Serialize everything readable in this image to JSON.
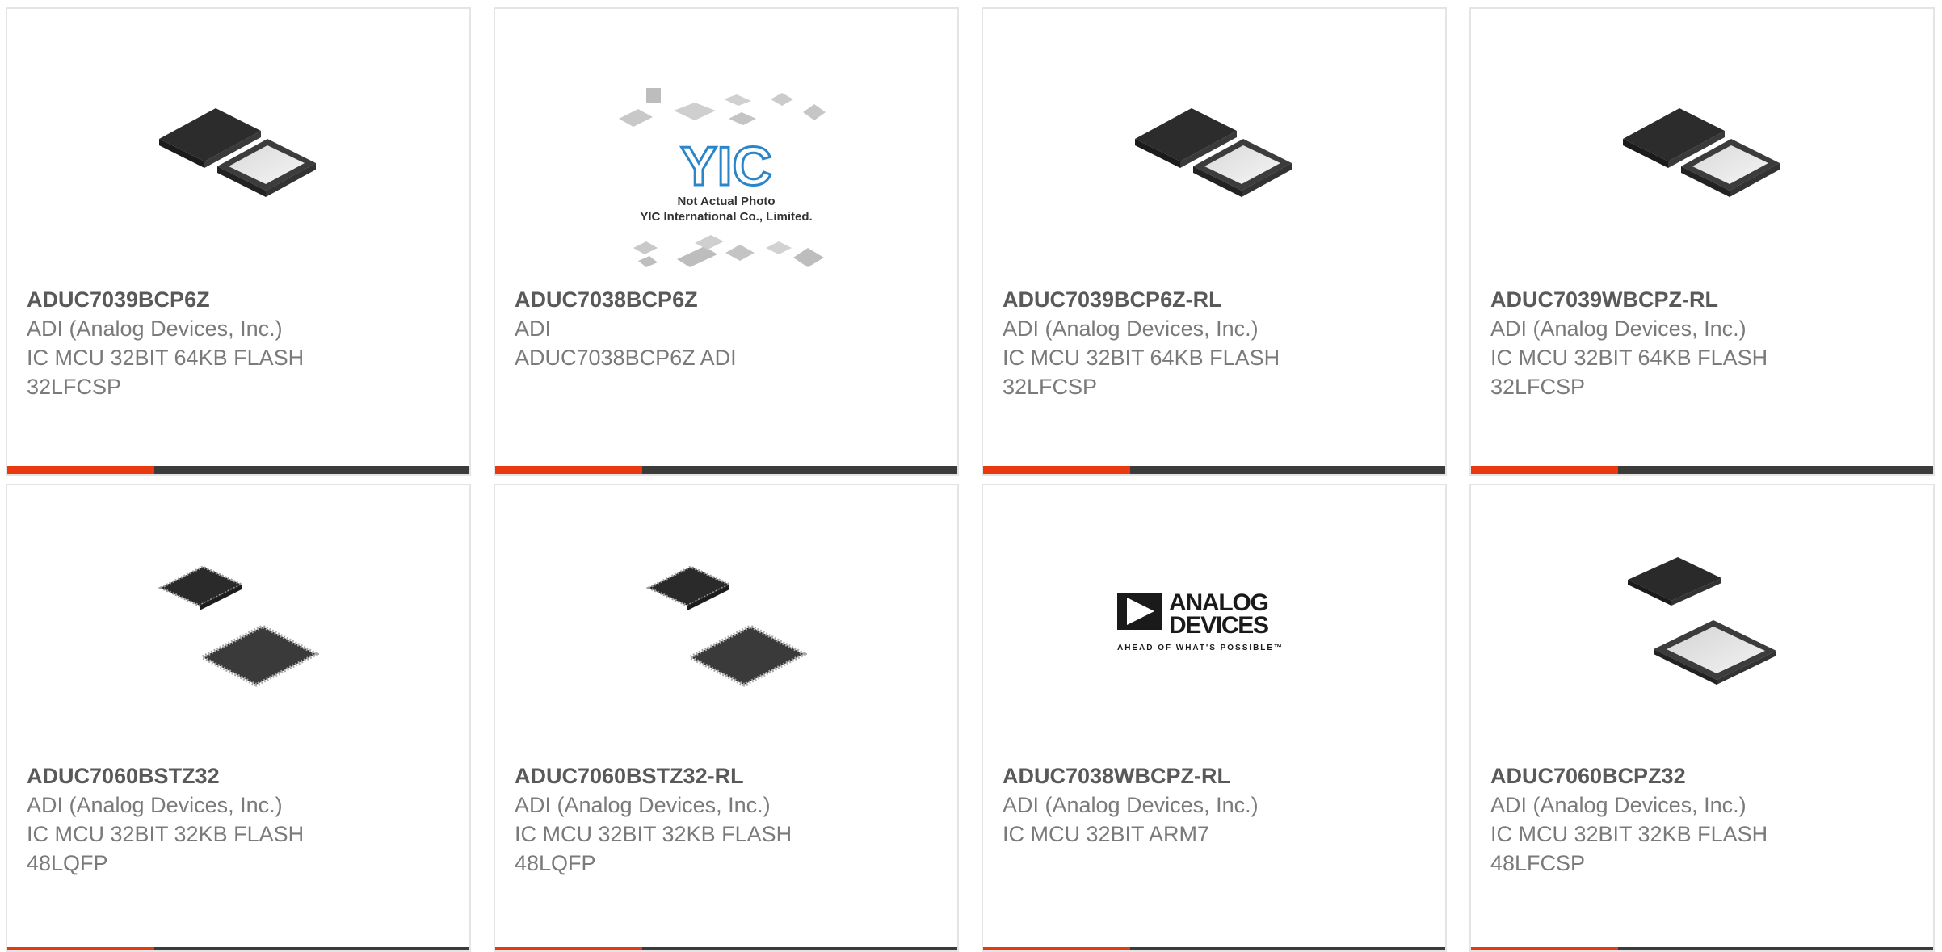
{
  "products": [
    {
      "part": "ADUC7039BCP6Z",
      "manufacturer": "ADI (Analog Devices, Inc.)",
      "description": "IC MCU 32BIT 64KB FLASH 32LFCSP",
      "image": "qfn-chip-icon"
    },
    {
      "part": "ADUC7038BCP6Z",
      "manufacturer": "ADI",
      "description": "ADUC7038BCP6Z ADI",
      "image": "placeholder-photo-icon",
      "placeholder": {
        "logo": "YIC",
        "line1": "Not Actual Photo",
        "line2": "YIC International Co., Limited."
      }
    },
    {
      "part": "ADUC7039BCP6Z-RL",
      "manufacturer": "ADI (Analog Devices, Inc.)",
      "description": "IC MCU 32BIT 64KB FLASH 32LFCSP",
      "image": "qfn-chip-icon"
    },
    {
      "part": "ADUC7039WBCPZ-RL",
      "manufacturer": "ADI (Analog Devices, Inc.)",
      "description": "IC MCU 32BIT 64KB FLASH 32LFCSP",
      "image": "qfn-chip-icon"
    },
    {
      "part": "ADUC7060BSTZ32",
      "manufacturer": "ADI (Analog Devices, Inc.)",
      "description": "IC MCU 32BIT 32KB FLASH 48LQFP",
      "image": "lqfp-chip-icon"
    },
    {
      "part": "ADUC7060BSTZ32-RL",
      "manufacturer": "ADI (Analog Devices, Inc.)",
      "description": "IC MCU 32BIT 32KB FLASH 48LQFP",
      "image": "lqfp-chip-icon"
    },
    {
      "part": "ADUC7038WBCPZ-RL",
      "manufacturer": "ADI (Analog Devices, Inc.)",
      "description": "IC MCU 32BIT ARM7",
      "image": "analog-devices-logo",
      "logo": {
        "line1": "ANALOG",
        "line2": "DEVICES",
        "tagline": "AHEAD OF WHAT'S POSSIBLE™"
      }
    },
    {
      "part": "ADUC7060BCPZ32",
      "manufacturer": "ADI (Analog Devices, Inc.)",
      "description": "IC MCU 32BIT 32KB FLASH 48LFCSP",
      "image": "lfcsp-chip-icon"
    }
  ],
  "colors": {
    "accent": "#e8390f",
    "bar": "#3b3b3b",
    "title": "#595959",
    "text": "#7a7a7a",
    "border": "#e4e4e4"
  }
}
